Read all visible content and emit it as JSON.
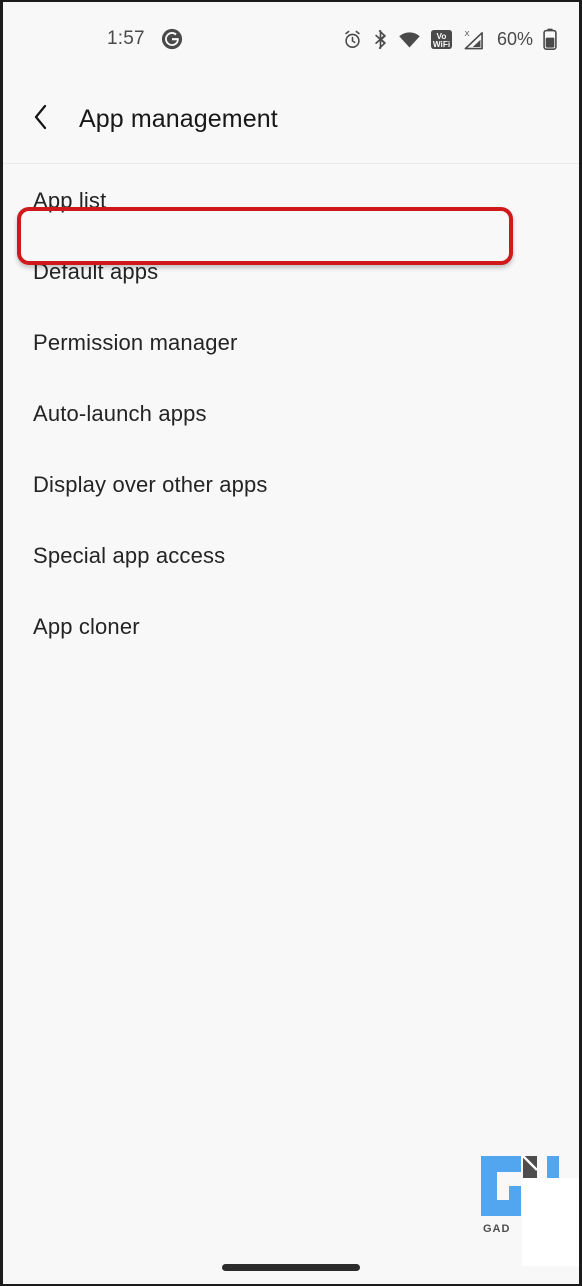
{
  "status_bar": {
    "time": "1:57",
    "google_icon": "google-g-icon",
    "icons": [
      "alarm-icon",
      "bluetooth-icon",
      "wifi-icon",
      "vowifi-icon",
      "cellular-signal-icon"
    ],
    "vowifi_label_top": "Vo",
    "vowifi_label_bottom": "WiFi",
    "signal_x_label": "X",
    "battery_percent": "60%",
    "battery_icon": "battery-icon"
  },
  "app_bar": {
    "back_icon": "chevron-left-icon",
    "title": "App management"
  },
  "list": {
    "items": [
      {
        "label": "App list",
        "highlighted": true
      },
      {
        "label": "Default apps",
        "highlighted": false
      },
      {
        "label": "Permission manager",
        "highlighted": false
      },
      {
        "label": "Auto-launch apps",
        "highlighted": false
      },
      {
        "label": "Display over other apps",
        "highlighted": false
      },
      {
        "label": "Special app access",
        "highlighted": false
      },
      {
        "label": "App cloner",
        "highlighted": false
      }
    ]
  },
  "highlight": {
    "color": "#cf191d",
    "target_label": "App list"
  },
  "watermark": {
    "text": "GAD",
    "primary_color": "#52a5ef",
    "secondary_color": "#4d4d4d"
  },
  "gesture_bar": {
    "name": "home-gesture-bar"
  },
  "theme": {
    "background": "#f8f8f8",
    "text_primary": "#242424",
    "text_secondary": "#4a4a4a",
    "divider": "#ebebeb"
  }
}
